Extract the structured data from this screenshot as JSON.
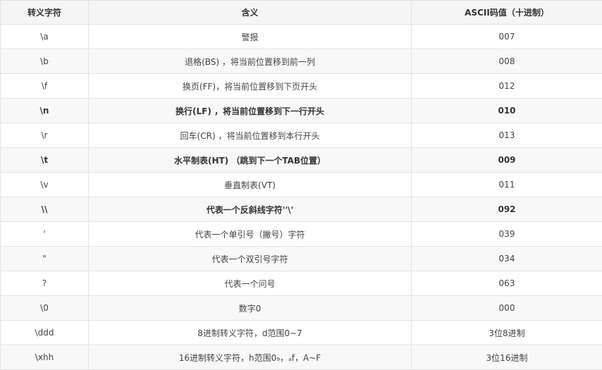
{
  "table": {
    "headers": [
      "转义字符",
      "含义",
      "ASCII码值（十进制）"
    ],
    "rows": [
      {
        "escape": "\\a",
        "meaning": "警报",
        "ascii": "007",
        "bold": false
      },
      {
        "escape": "\\b",
        "meaning": "退格(BS) ，将当前位置移到前一列",
        "ascii": "008",
        "bold": false
      },
      {
        "escape": "\\f",
        "meaning": "换页(FF)，将当前位置移到下页开头",
        "ascii": "012",
        "bold": false
      },
      {
        "escape": "\\n",
        "meaning": "换行(LF) ，将当前位置移到下一行开头",
        "ascii": "010",
        "bold": true
      },
      {
        "escape": "\\r",
        "meaning": "回车(CR) ，将当前位置移到本行开头",
        "ascii": "013",
        "bold": false
      },
      {
        "escape": "\\t",
        "meaning": "水平制表(HT) （跳到下一个TAB位置）",
        "ascii": "009",
        "bold": true
      },
      {
        "escape": "\\v",
        "meaning": "垂直制表(VT)",
        "ascii": "011",
        "bold": false
      },
      {
        "escape": "\\\\",
        "meaning": "代表一个反斜线字符''\\'",
        "ascii": "092",
        "bold": true
      },
      {
        "escape": "'",
        "meaning": "代表一个单引号（撇号）字符",
        "ascii": "039",
        "bold": false
      },
      {
        "escape": "\"",
        "meaning": "代表一个双引号字符",
        "ascii": "034",
        "bold": false
      },
      {
        "escape": "?",
        "meaning": "代表一个问号",
        "ascii": "063",
        "bold": false
      },
      {
        "escape": "\\0",
        "meaning": "数字0",
        "ascii": "000",
        "bold": false
      },
      {
        "escape": "\\ddd",
        "meaning": "8进制转义字符，d范围0~7",
        "ascii": "3位8进制",
        "bold": false
      },
      {
        "escape": "\\xhh",
        "meaning": "16进制转义字符，h范围0₉，ₐf，A~F",
        "ascii": "3位16进制",
        "bold": false
      }
    ]
  }
}
